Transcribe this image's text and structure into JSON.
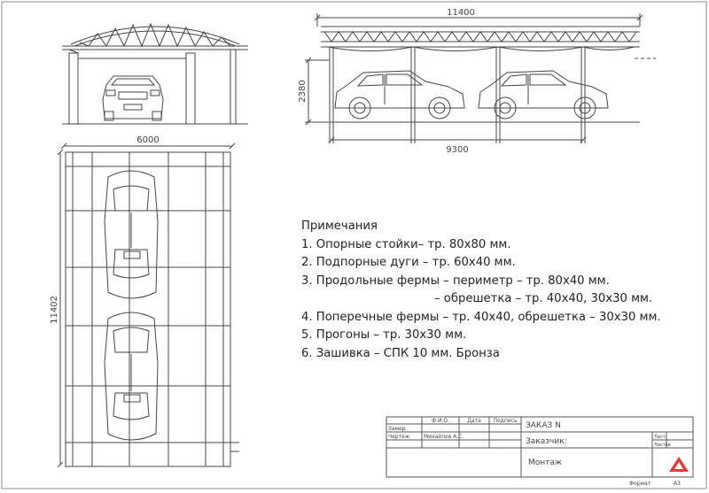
{
  "notes": {
    "heading": "Примечания",
    "lines": [
      "1. Опорные стойки– тр. 80x80 мм.",
      "2. Подпорные дуги – тр. 60x40 мм.",
      "3. Продольные фермы – периметр – тр. 80x40 мм.",
      "– обрешетка – тр. 40x40, 30x30 мм.",
      "4. Поперечные фермы – тр. 40x40, обрешетка – 30x30 мм.",
      "5. Прогоны – тр. 30x30 мм.",
      "6. Зашивка – СПК 10 мм. Бронза"
    ]
  },
  "dimensions": {
    "top_length": "11400",
    "height": "2380",
    "support_span": "9300",
    "plan_width": "6000",
    "plan_length": "11402"
  },
  "title_block": {
    "fio": "Ф.И.О.",
    "date": "Дата",
    "signature": "Подпись",
    "order": "ЗАКАЗ N",
    "row_label_1": "Замер",
    "row_label_2": "Чертеж",
    "drafter": "Михайлов А.С.",
    "customer": "Заказчик:",
    "sheet_label": "Лист",
    "sheets_label": "Листов",
    "stage": "Монтаж",
    "format_label": "Формат",
    "format_value": "А3"
  },
  "colors": {
    "line": "#444444",
    "logo": "#e53935"
  }
}
